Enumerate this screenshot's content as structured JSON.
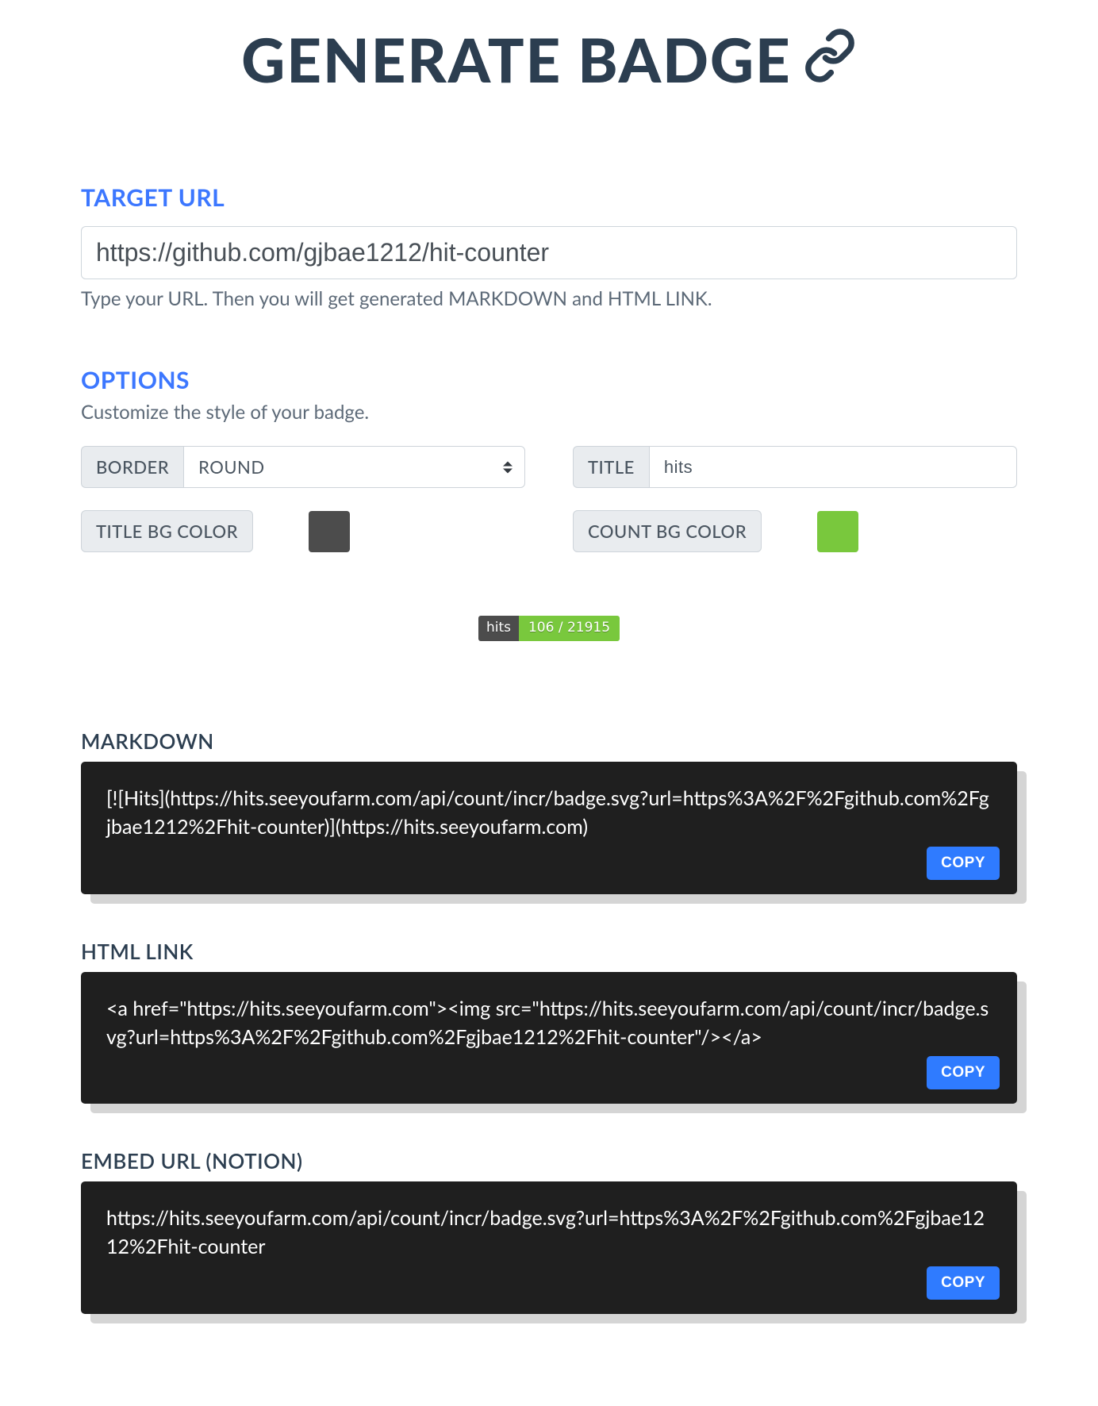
{
  "hero": {
    "title": "GENERATE BADGE"
  },
  "icons": {
    "link": "link-icon"
  },
  "target": {
    "heading": "TARGET URL",
    "value": "https://github.com/gjbae1212/hit-counter",
    "hint": "Type your URL. Then you will get generated MARKDOWN and HTML LINK."
  },
  "options": {
    "heading": "OPTIONS",
    "hint": "Customize the style of your badge.",
    "border": {
      "label": "BORDER",
      "selected": "ROUND"
    },
    "title": {
      "label": "TITLE",
      "value": "hits"
    },
    "title_bg": {
      "label": "TITLE BG COLOR",
      "color": "#4c4c4c"
    },
    "count_bg": {
      "label": "COUNT BG COLOR",
      "color": "#79c83d"
    }
  },
  "badge_preview": {
    "title_text": "hits",
    "count_text": "106 / 21915",
    "title_bg": "#4c4c4c",
    "count_bg": "#79c83d"
  },
  "outputs": {
    "markdown": {
      "title": "MARKDOWN",
      "code": "[![Hits](https://hits.seeyoufarm.com/api/count/incr/badge.svg?url=https%3A%2F%2Fgithub.com%2Fgjbae1212%2Fhit-counter)](https://hits.seeyoufarm.com)"
    },
    "html": {
      "title": "HTML LINK",
      "code": "<a href=\"https://hits.seeyoufarm.com\"><img src=\"https://hits.seeyoufarm.com/api/count/incr/badge.svg?url=https%3A%2F%2Fgithub.com%2Fgjbae1212%2Fhit-counter\"/></a>"
    },
    "embed": {
      "title": "EMBED URL (NOTION)",
      "code": "https://hits.seeyoufarm.com/api/count/incr/badge.svg?url=https%3A%2F%2Fgithub.com%2Fgjbae1212%2Fhit-counter"
    }
  },
  "labels": {
    "copy": "COPY"
  }
}
